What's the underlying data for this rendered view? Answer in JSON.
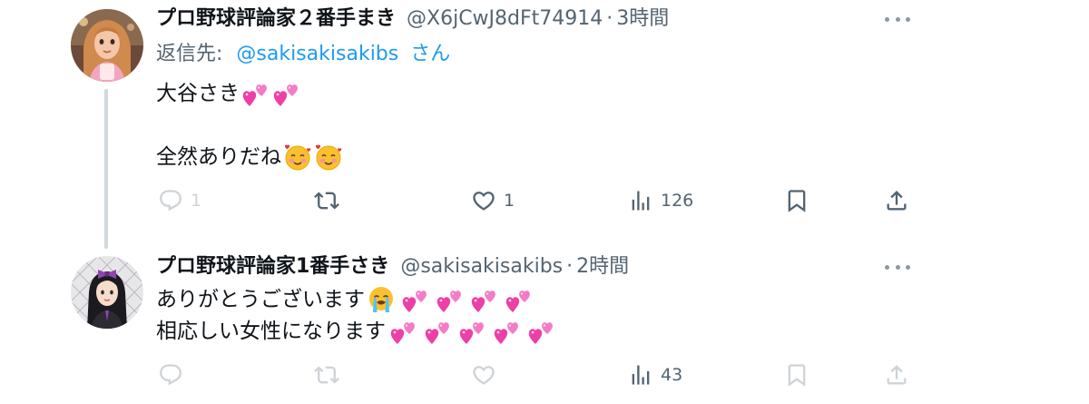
{
  "tweets": [
    {
      "display_name": "プロ野球評論家２番手まき",
      "handle": "@X6jCwJ8dFt74914",
      "separator": "·",
      "time": "3時間",
      "reply_label": "返信先:",
      "reply_mention": "@sakisakisakibs",
      "reply_suffix": "さん",
      "lines": [
        "大谷さき",
        "全然ありだね"
      ],
      "emojis": [
        "heart-two",
        "heart-two",
        "smiling-face-with-hearts",
        "smiling-face-with-hearts"
      ],
      "actions": {
        "reply_count": "1",
        "retweet_count": "",
        "like_count": "1",
        "views_count": "126"
      }
    },
    {
      "display_name": "プロ野球評論家1番手さき",
      "handle": "@sakisakisakibs",
      "separator": "·",
      "time": "2時間",
      "lines": [
        "ありがとうございます",
        "相応しい女性になります"
      ],
      "emojis": [
        "loudly-crying-face",
        "heart-two",
        "heart-two",
        "heart-two",
        "heart-two",
        "heart-two",
        "heart-two",
        "heart-two",
        "heart-two",
        "heart-two"
      ],
      "actions": {
        "reply_count": "",
        "retweet_count": "",
        "like_count": "",
        "views_count": "43"
      }
    }
  ],
  "colors": {
    "text": "#0f1419",
    "secondary": "#536471",
    "link": "#1d9bf0",
    "thread_line": "#cfd9de",
    "heart_emoji": "#ee3fa8"
  }
}
